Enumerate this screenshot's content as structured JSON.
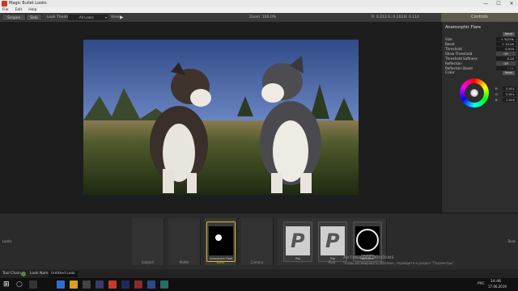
{
  "window": {
    "title": "Magic Bullet Looks",
    "min_glyph": "—",
    "max_glyph": "☐",
    "close_glyph": "✕"
  },
  "menu": [
    "File",
    "Edit",
    "Help"
  ],
  "toolbar": {
    "scopes": "Scopes",
    "solo": "Solo",
    "look_theatre": "Look Theatre:",
    "look_theatre_value": "All Looks",
    "view": "View",
    "zoom": "Zoom:  100.0%",
    "coords": [
      "R: 0.212",
      "G: 0.102",
      "B: 0.114"
    ],
    "controls_tab": "Controls"
  },
  "controls": {
    "title": "Anamorphic Flare",
    "reset": "Reset",
    "params": [
      {
        "label": "Size",
        "value": "+ %22%"
      },
      {
        "label": "Boost",
        "value": "+ 10.00"
      },
      {
        "label": "Threshold",
        "value": "0.910"
      },
      {
        "label": "Show Threshold",
        "value": "Off"
      },
      {
        "label": "Threshold Softness",
        "value": "0.20"
      },
      {
        "label": "Reflection",
        "value": "Off"
      },
      {
        "label": "Reflection Boost",
        "value": "-7.00"
      }
    ],
    "color": {
      "title": "Color",
      "reset": "Reset",
      "r_label": "R",
      "r": "0.001",
      "g_label": "G",
      "g": "0.001",
      "b_label": "B",
      "b": "2.000"
    }
  },
  "bottom": {
    "left_side": "Looks",
    "right_side": "Tools",
    "slots": [
      "Subject",
      "Matte",
      "Lens",
      "Camera",
      "Post"
    ],
    "cards": [
      {
        "name": "Anamorphic Flare",
        "selected": true
      },
      {
        "name": "Pop",
        "selected": false
      },
      {
        "name": "Pop",
        "selected": false
      },
      {
        "name": "Chromatic Aberration",
        "selected": false
      }
    ]
  },
  "status": {
    "tool_chain": "Tool Chain",
    "look_name_label": "Look Name:",
    "look_name_value": "Untitled Look"
  },
  "watermark": {
    "line1": "Активация Windows",
    "line2": "Чтобы активировать Windows, перейдите в раздел \"Параметры\"."
  },
  "taskbar": {
    "lang": "РУС",
    "time": "14:46",
    "date": "17.06.2019"
  }
}
